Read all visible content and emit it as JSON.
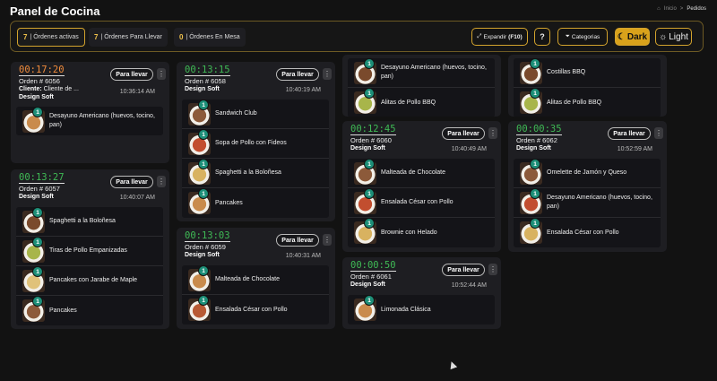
{
  "header": {
    "title": "Panel de Cocina"
  },
  "breadcrumb": {
    "home": "Inicio",
    "sep": ">",
    "current": "Pedidos"
  },
  "stats": [
    {
      "count": "7",
      "label": "| Órdenes activas"
    },
    {
      "count": "7",
      "label": "| Órdenes Para Llevar"
    },
    {
      "count": "0",
      "label": "| Órdenes En Mesa"
    }
  ],
  "toolbar": {
    "expand_label": "Expandir",
    "expand_key": "(F10)",
    "help": "?",
    "categories": "Categorias",
    "dark": "Dark",
    "light": "Light"
  },
  "orders": [
    {
      "timer": "00:17:20",
      "order": "Orden # 6056",
      "client_label": "Cliente:",
      "client": "Cliente de ...",
      "time": "10:36:14 AM",
      "company": "Design Soft",
      "pickup": "Para llevar",
      "more": "⋮",
      "items": [
        {
          "qty": "1",
          "name": "Desayuno Americano (huevos, tocino, pan)"
        }
      ]
    },
    {
      "timer": "00:13:27",
      "order": "Orden # 6057",
      "time": "10:40:07 AM",
      "company": "Design Soft",
      "pickup": "Para llevar",
      "more": "⋮",
      "items": [
        {
          "qty": "1",
          "name": "Spaghetti a la Boloñesa"
        },
        {
          "qty": "1",
          "name": "Tiras de Pollo Empanizadas"
        },
        {
          "qty": "1",
          "name": "Pancakes con Jarabe de Maple"
        },
        {
          "qty": "1",
          "name": "Pancakes"
        }
      ]
    },
    {
      "timer": "00:13:15",
      "order": "Orden # 6058",
      "time": "10:40:19 AM",
      "company": "Design Soft",
      "pickup": "Para llevar",
      "more": "⋮",
      "items": [
        {
          "qty": "1",
          "name": "Sandwich Club"
        },
        {
          "qty": "1",
          "name": "Sopa de Pollo con Fideos"
        },
        {
          "qty": "1",
          "name": "Spaghetti a la Boloñesa"
        },
        {
          "qty": "1",
          "name": "Pancakes"
        }
      ]
    },
    {
      "timer": "00:13:03",
      "order": "Orden # 6059",
      "time": "10:40:31 AM",
      "company": "Design Soft",
      "pickup": "Para llevar",
      "more": "⋮",
      "items": [
        {
          "qty": "1",
          "name": "Malteada de Chocolate"
        },
        {
          "qty": "1",
          "name": "Ensalada César con Pollo"
        }
      ]
    },
    {
      "items": [
        {
          "qty": "1",
          "name": "Desayuno Americano (huevos, tocino, pan)"
        },
        {
          "qty": "1",
          "name": "Alitas de Pollo BBQ"
        }
      ]
    },
    {
      "timer": "00:12:45",
      "order": "Orden # 6060",
      "time": "10:40:49 AM",
      "company": "Design Soft",
      "pickup": "Para llevar",
      "more": "⋮",
      "items": [
        {
          "qty": "1",
          "name": "Malteada de Chocolate"
        },
        {
          "qty": "1",
          "name": "Ensalada César con Pollo"
        },
        {
          "qty": "1",
          "name": "Brownie con Helado"
        }
      ]
    },
    {
      "timer": "00:00:50",
      "order": "Orden # 6061",
      "time": "10:52:44 AM",
      "company": "Design Soft",
      "pickup": "Para llevar",
      "more": "⋮",
      "items": [
        {
          "qty": "1",
          "name": "Limonada Clásica"
        }
      ]
    },
    {
      "items": [
        {
          "qty": "1",
          "name": "Costillas BBQ"
        },
        {
          "qty": "1",
          "name": "Alitas de Pollo BBQ"
        }
      ]
    },
    {
      "timer": "00:00:35",
      "order": "Orden # 6062",
      "time": "10:52:59 AM",
      "company": "Design Soft",
      "pickup": "Para llevar",
      "more": "⋮",
      "items": [
        {
          "qty": "1",
          "name": "Omelette de Jamón y Queso"
        },
        {
          "qty": "1",
          "name": "Desayuno Americano (huevos, tocino, pan)"
        },
        {
          "qty": "1",
          "name": "Ensalada César con Pollo"
        }
      ]
    }
  ],
  "colors": {
    "accent": "#d9a21b",
    "timer_orange": "#f08b3b",
    "timer_green": "#3fba55",
    "badge": "#1d8f78"
  }
}
